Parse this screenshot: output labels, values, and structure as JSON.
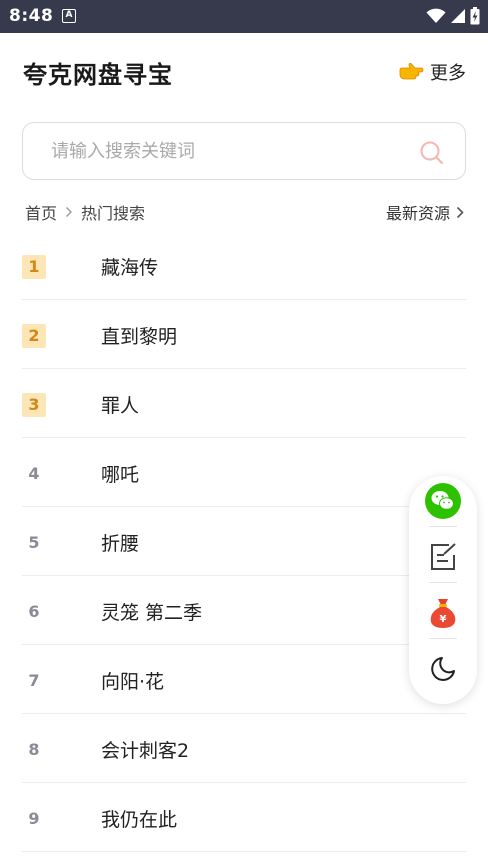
{
  "status": {
    "time": "8:48",
    "notif_glyph": "A"
  },
  "header": {
    "title": "夸克网盘寻宝",
    "more_icon": "pointing-hand-emoji",
    "more_label": "更多"
  },
  "search": {
    "placeholder": "请输入搜索关键词",
    "value": ""
  },
  "breadcrumb": {
    "home": "首页",
    "current": "热门搜索",
    "latest_label": "最新资源"
  },
  "hot_list": [
    {
      "rank": "1",
      "title": "藏海传",
      "highlight": true
    },
    {
      "rank": "2",
      "title": "直到黎明",
      "highlight": true
    },
    {
      "rank": "3",
      "title": "罪人",
      "highlight": true
    },
    {
      "rank": "4",
      "title": "哪吒",
      "highlight": false
    },
    {
      "rank": "5",
      "title": "折腰",
      "highlight": false
    },
    {
      "rank": "6",
      "title": "灵笼 第二季",
      "highlight": false
    },
    {
      "rank": "7",
      "title": "向阳·花",
      "highlight": false
    },
    {
      "rank": "8",
      "title": "会计刺客2",
      "highlight": false
    },
    {
      "rank": "9",
      "title": "我仍在此",
      "highlight": false
    }
  ],
  "float_actions": [
    "wechat-icon",
    "feedback-edit-icon",
    "money-bag-icon",
    "dark-mode-moon-icon"
  ],
  "colors": {
    "status_bar": "#373a4d",
    "rank_top_bg": "#fde6b6",
    "rank_top_text": "#d0881a",
    "rank_text": "#8a8a98",
    "wechat_green": "#2dc100",
    "search_icon": "#f6b6b6"
  }
}
